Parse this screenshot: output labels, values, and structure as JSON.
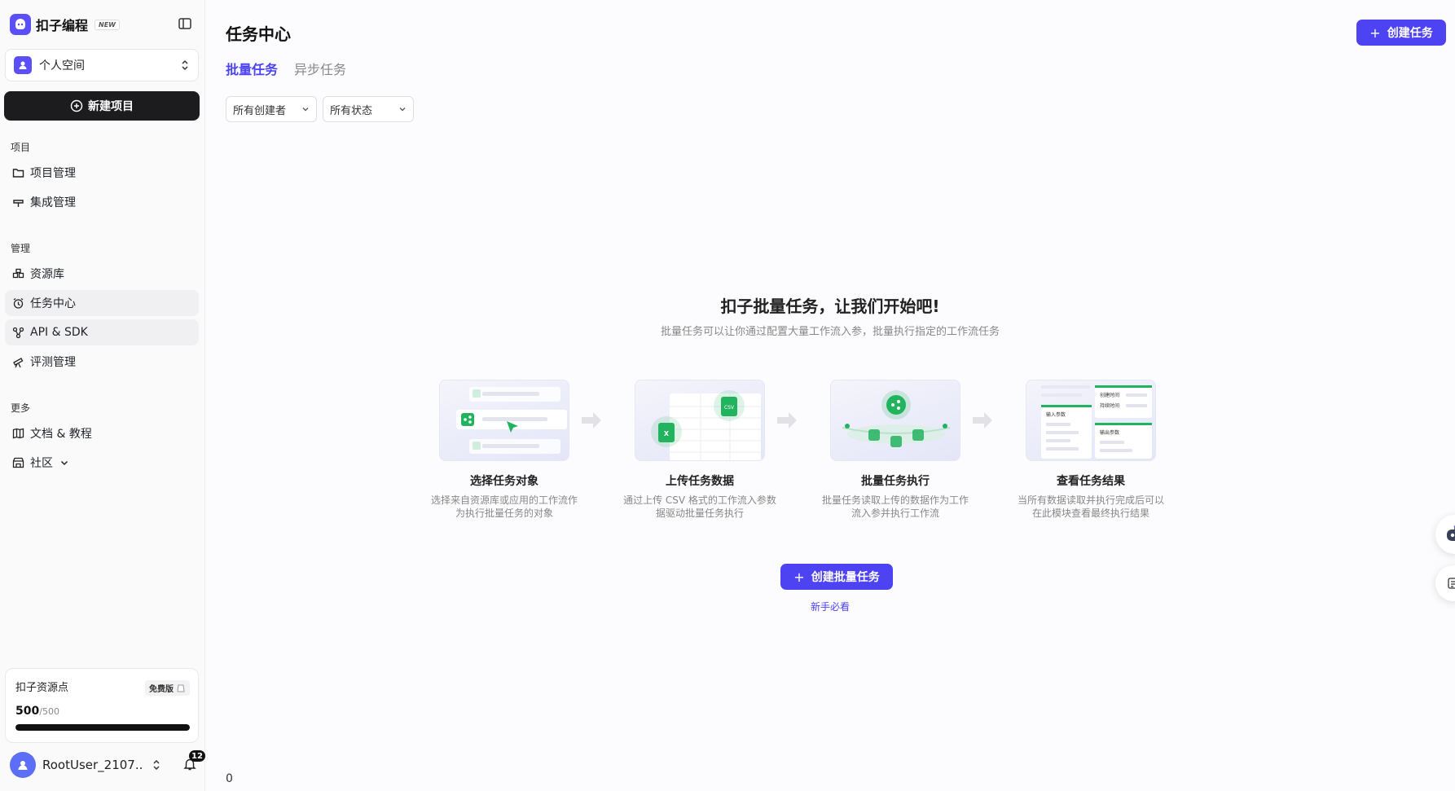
{
  "brand": {
    "name": "扣子编程",
    "badge": "NEW"
  },
  "space": {
    "label": "个人空间"
  },
  "sidebar": {
    "new_project": "新建项目",
    "sections": [
      {
        "title": "项目",
        "items": [
          {
            "label": "项目管理",
            "icon": "folder-icon"
          },
          {
            "label": "集成管理",
            "icon": "plug-icon"
          }
        ]
      },
      {
        "title": "管理",
        "items": [
          {
            "label": "资源库",
            "icon": "library-icon"
          },
          {
            "label": "任务中心",
            "icon": "alarm-clock-icon"
          },
          {
            "label": "API & SDK",
            "icon": "api-icon"
          },
          {
            "label": "评测管理",
            "icon": "telescope-icon"
          }
        ]
      },
      {
        "title": "更多",
        "items": [
          {
            "label": "文档 & 教程",
            "icon": "book-icon"
          },
          {
            "label": "社区",
            "icon": "store-icon"
          }
        ]
      }
    ]
  },
  "credits": {
    "title": "扣子资源点",
    "plan": "免费版",
    "value": "500",
    "max": "/500",
    "fraction": 1.0
  },
  "user": {
    "name": "RootUser_2107...",
    "notifications": "12"
  },
  "header": {
    "title": "任务中心",
    "create_task": "创建任务"
  },
  "tabs": [
    {
      "label": "批量任务",
      "active": true
    },
    {
      "label": "异步任务",
      "active": false
    }
  ],
  "filters": {
    "creator": "所有创建者",
    "status": "所有状态"
  },
  "empty_state": {
    "title": "扣子批量任务，让我们开始吧!",
    "subtitle": "批量任务可以让你通过配置大量工作流入参，批量执行指定的工作流任务",
    "steps": [
      {
        "title": "选择任务对象",
        "desc": "选择来自资源库或应用的工作流作为执行批量任务的对象"
      },
      {
        "title": "上传任务数据",
        "desc": "通过上传 CSV 格式的工作流入参数据驱动批量任务执行"
      },
      {
        "title": "批量任务执行",
        "desc": "批量任务读取上传的数据作为工作流入参并执行工作流"
      },
      {
        "title": "查看任务结果",
        "desc": "当所有数据读取并执行完成后可以在此模块查看最终执行结果"
      }
    ],
    "create_batch": "创建批量任务",
    "guide": "新手必看",
    "illus": {
      "csv": "CSV",
      "x": "X",
      "c1": "创建时间",
      "c2": "持续时间",
      "c3": "输入参数",
      "c4": "输出参数"
    }
  },
  "footer": {
    "count": "0"
  },
  "colors": {
    "accent": "#4d43f3",
    "green": "#22b35e",
    "dark": "#1c1c1f"
  }
}
